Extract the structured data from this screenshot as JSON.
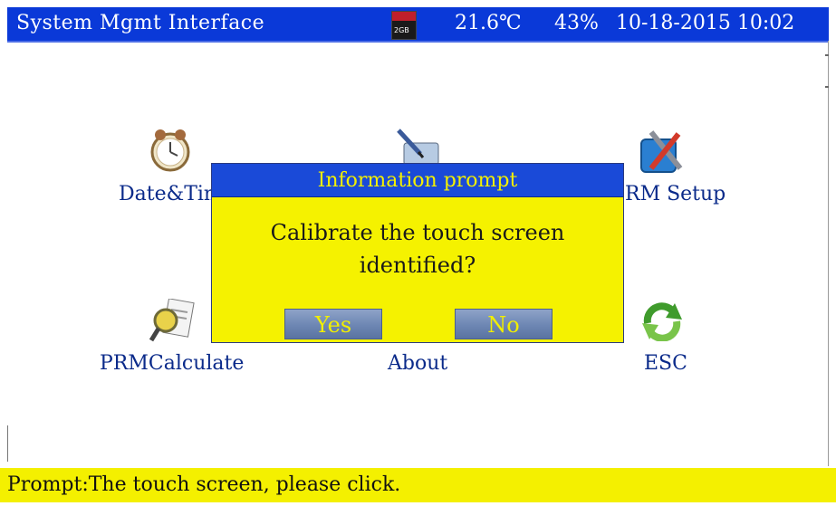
{
  "header": {
    "title": "System Mgmt Interface",
    "sd_icon": "sd-card-icon",
    "sd_label": "2GB",
    "temperature": "21.6℃",
    "humidity": "43%",
    "datetime": "10-18-2015 10:02"
  },
  "menu": {
    "items": [
      {
        "label": "Date&Tim",
        "icon": "clock-icon"
      },
      {
        "label": "",
        "icon": "stylus-tablet-icon"
      },
      {
        "label": "RM Setup",
        "icon": "tools-icon"
      },
      {
        "label": "PRMCalculate",
        "icon": "magnifier-document-icon"
      },
      {
        "label": "About",
        "icon": ""
      },
      {
        "label": "ESC",
        "icon": "green-refresh-icon"
      }
    ]
  },
  "dialog": {
    "title": "Information prompt",
    "message": "Calibrate the touch screen\n    identified?",
    "yes_label": "Yes",
    "no_label": "No"
  },
  "prompt": {
    "text": "Prompt:The touch screen, please click."
  },
  "colors": {
    "header_blue": "#0a39d8",
    "dialog_yellow": "#f5f200",
    "prompt_yellow": "#f4f000",
    "label_blue": "#0a2a8a"
  }
}
